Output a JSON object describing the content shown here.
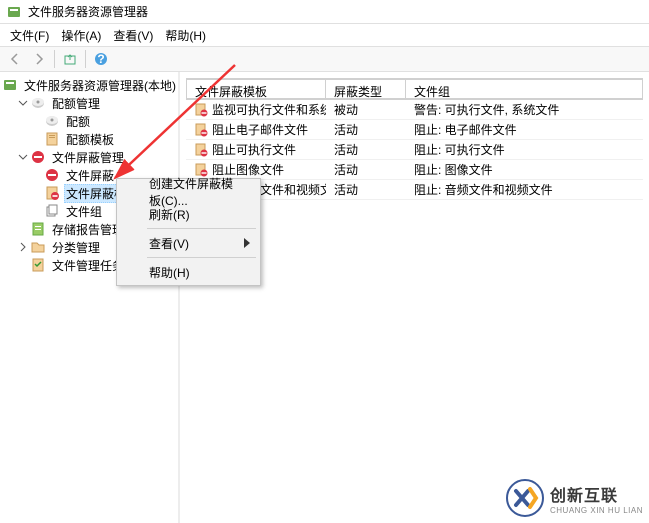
{
  "window": {
    "title": "文件服务器资源管理器"
  },
  "menubar": [
    {
      "label": "文件(F)"
    },
    {
      "label": "操作(A)"
    },
    {
      "label": "查看(V)"
    },
    {
      "label": "帮助(H)"
    }
  ],
  "tree": {
    "root": {
      "label": "文件服务器资源管理器(本地)"
    },
    "nodes": [
      {
        "label": "配额管理",
        "expanded": true,
        "children": [
          {
            "label": "配额"
          },
          {
            "label": "配额模板"
          }
        ]
      },
      {
        "label": "文件屏蔽管理",
        "expanded": true,
        "children": [
          {
            "label": "文件屏蔽"
          },
          {
            "label": "文件屏蔽模板",
            "selected": true
          },
          {
            "label": "文件组"
          }
        ]
      },
      {
        "label": "存储报告管理"
      },
      {
        "label": "分类管理",
        "expanded": false
      },
      {
        "label": "文件管理任务"
      }
    ]
  },
  "list": {
    "columns": {
      "name": "文件屏蔽模板",
      "type": "屏蔽类型",
      "group": "文件组"
    },
    "rows": [
      {
        "name": "监视可执行文件和系统文件",
        "type": "被动",
        "group": "警告: 可执行文件, 系统文件"
      },
      {
        "name": "阻止电子邮件文件",
        "type": "活动",
        "group": "阻止: 电子邮件文件"
      },
      {
        "name": "阻止可执行文件",
        "type": "活动",
        "group": "阻止: 可执行文件"
      },
      {
        "name": "阻止图像文件",
        "type": "活动",
        "group": "阻止: 图像文件"
      },
      {
        "name": "阻止音频文件和视频文件",
        "type": "活动",
        "group": "阻止: 音频文件和视频文件"
      }
    ]
  },
  "context_menu": [
    {
      "label": "创建文件屏蔽模板(C)...",
      "type": "item"
    },
    {
      "label": "刷新(R)",
      "type": "item"
    },
    {
      "type": "sep"
    },
    {
      "label": "查看(V)",
      "type": "submenu"
    },
    {
      "type": "sep"
    },
    {
      "label": "帮助(H)",
      "type": "item"
    }
  ],
  "watermark": {
    "cn": "创新互联",
    "en": "CHUANG XIN HU LIAN"
  }
}
